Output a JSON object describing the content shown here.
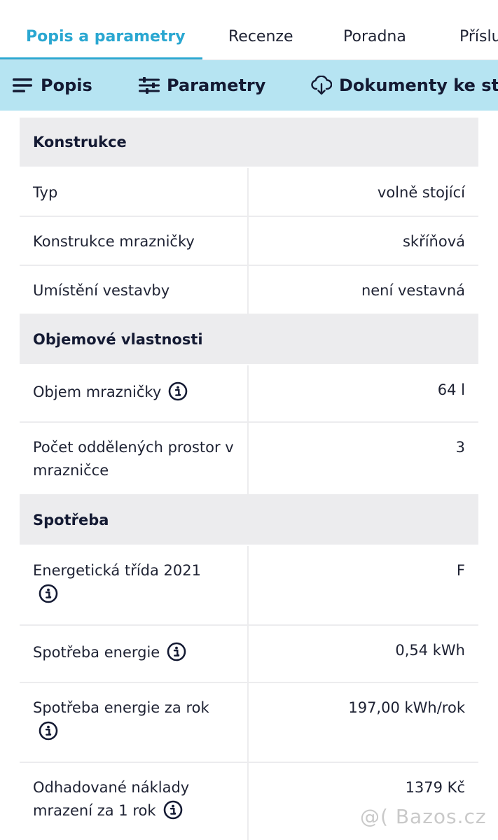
{
  "tabs": [
    {
      "label": "Popis a parametry",
      "active": true
    },
    {
      "label": "Recenze"
    },
    {
      "label": "Poradna"
    },
    {
      "label": "Příslu"
    }
  ],
  "subnav": {
    "popis": {
      "label": "Popis",
      "icon": "menu-lines-icon"
    },
    "parametry": {
      "label": "Parametry",
      "icon": "sliders-icon"
    },
    "dokumenty": {
      "label": "Dokumenty ke sta",
      "icon": "cloud-download-icon"
    }
  },
  "sections": {
    "konstrukce": {
      "title": "Konstrukce",
      "rows": [
        {
          "label": "Typ",
          "value": "volně stojící"
        },
        {
          "label": "Konstrukce mrazničky",
          "value": "skříňová"
        },
        {
          "label": "Umístění vestavby",
          "value": "není vestavná"
        }
      ]
    },
    "objem": {
      "title": "Objemové vlastnosti",
      "rows": [
        {
          "label": "Objem mrazničky",
          "value": "64 l"
        },
        {
          "label": "Počet oddělených prostor v mrazničce",
          "value": "3"
        }
      ]
    },
    "spotreba": {
      "title": "Spotřeba",
      "rows": [
        {
          "label": "Energetická třída 2021",
          "value": "F"
        },
        {
          "label": "Spotřeba energie",
          "value": "0,54 kWh"
        },
        {
          "label": "Spotřeba energie za rok",
          "value": "197,00 kWh/rok"
        },
        {
          "label": "Odhadované náklady mrazení za 1 rok",
          "value": "1379 Kč"
        }
      ]
    }
  },
  "watermark": "@( Bazos.cz",
  "colors": {
    "accent": "#2aa7d1",
    "subnav_bg": "#b6e4f2",
    "text": "#1e2233",
    "section_bg": "#ececee"
  }
}
